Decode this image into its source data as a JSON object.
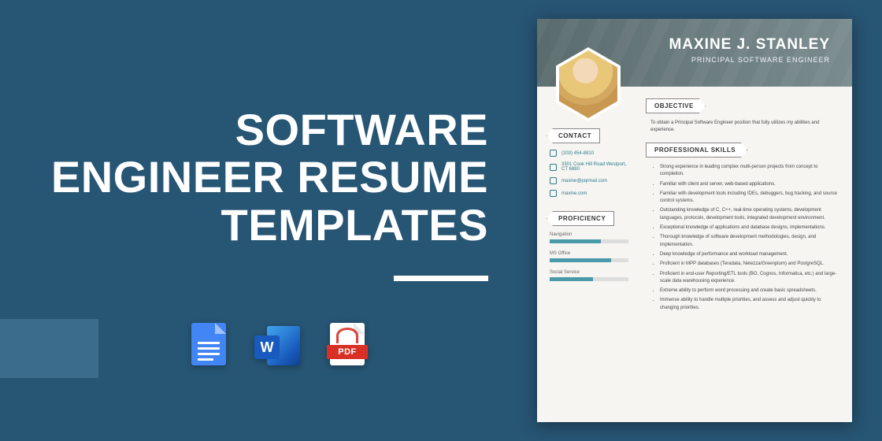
{
  "headline": {
    "l1": "SOFTWARE",
    "l2": "ENGINEER RESUME",
    "l3": "TEMPLATES"
  },
  "icons": {
    "word_letter": "W",
    "pdf_label": "PDF"
  },
  "resume": {
    "name": "MAXINE J. STANLEY",
    "role": "PRINCIPAL SOFTWARE ENGINEER",
    "contact_heading": "CONTACT",
    "contacts": [
      {
        "v": "(203) 454-8810"
      },
      {
        "v": "3301 Cook Hill Road Westport, CT 6880"
      },
      {
        "v": "maxine@pqrmail.com"
      },
      {
        "v": "maxine.com"
      }
    ],
    "proficiency_heading": "PROFICIENCY",
    "prof": [
      {
        "label": "Navigation",
        "pct": 65
      },
      {
        "label": "MS Office",
        "pct": 78
      },
      {
        "label": "Social Service",
        "pct": 55
      }
    ],
    "objective_heading": "OBJECTIVE",
    "objective_text": "To obtain a Principal Software Engineer position that fully utilizes my abilities and experience.",
    "skills_heading": "PROFESSIONAL SKILLS",
    "skills": [
      "Strong experience in leading complex multi-person projects from concept to completion.",
      "Familiar with client and server, web-based applications.",
      "Familiar with development tools including IDEs, debuggers, bug tracking, and source control systems.",
      "Outstanding knowledge of C, C++, real-time operating systems, development languages, protocols, development tools, integrated development environment.",
      "Exceptional knowledge of applications and database designs, implementations.",
      "Thorough knowledge of software development methodologies, design, and implementation.",
      "Deep knowledge of performance and workload management.",
      "Proficient in MPP databases (Teradata, Netezza/Greenplum) and PostgreSQL.",
      "Proficient in end-user Reporting/ETL tools (BO, Cognos, Informatica, etc.) and large-scale data warehousing experience.",
      "Extreme ability to perform word processing and create basic spreadsheets.",
      "Immense ability to handle multiple priorities, and assess and adjust quickly to changing priorities."
    ]
  }
}
